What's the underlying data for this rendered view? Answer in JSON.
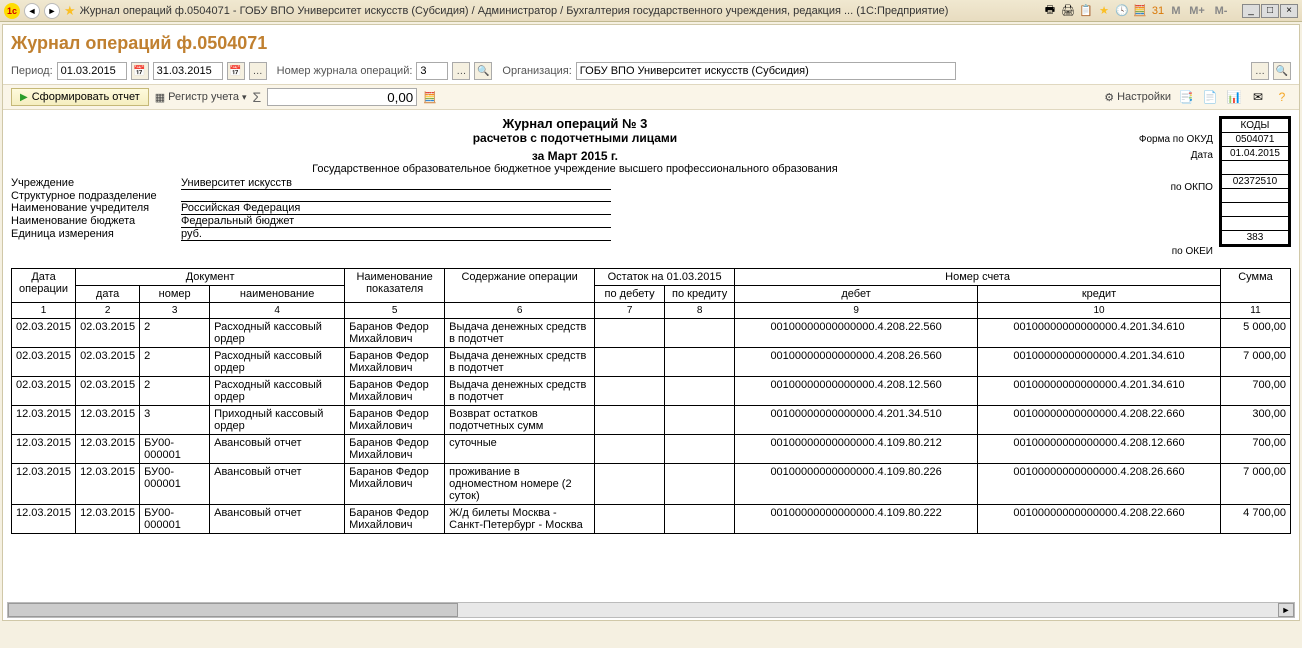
{
  "titlebar": {
    "text": "Журнал операций ф.0504071 - ГОБУ ВПО Университет искусств (Субсидия) / Администратор / Бухгалтерия государственного учреждения, редакция ...  (1С:Предприятие)",
    "m_btns": [
      "M",
      "M+",
      "M-"
    ]
  },
  "page_title": "Журнал операций ф.0504071",
  "params": {
    "period_label": "Период:",
    "date_from": "01.03.2015",
    "date_to": "31.03.2015",
    "journal_num_label": "Номер журнала операций:",
    "journal_num": "3",
    "org_label": "Организация:",
    "org": "ГОБУ ВПО Университет искусств (Субсидия)"
  },
  "toolbar": {
    "generate": "Сформировать отчет",
    "register": "Регистр учета",
    "sum": "0,00",
    "settings": "Настройки"
  },
  "report": {
    "title1": "Журнал операций № 3",
    "title2": "расчетов с подотчетными лицами",
    "title3": "за Март 2015 г.",
    "org_line": "Государственное образовательное бюджетное учреждение высшего профессионального образования",
    "info": {
      "uchr_lbl": "Учреждение",
      "uchr_val": "Университет искусств",
      "podr_lbl": "Структурное подразделение",
      "podr_val": "",
      "founder_lbl": "Наименование учредителя",
      "founder_val": "Российская Федерация",
      "budget_lbl": "Наименование бюджета",
      "budget_val": "Федеральный бюджет",
      "unit_lbl": "Единица измерения",
      "unit_val": "руб."
    },
    "codes": {
      "head": "КОДЫ",
      "okud_lbl": "Форма по ОКУД",
      "okud": "0504071",
      "date_lbl": "Дата",
      "date": "01.04.2015",
      "okpo_lbl": "по ОКПО",
      "okpo": "02372510",
      "okei_lbl": "по ОКЕИ",
      "okei": "383"
    },
    "headers": {
      "op_date": "Дата операции",
      "doc": "Документ",
      "doc_date": "дата",
      "doc_num": "номер",
      "doc_name": "наименование",
      "indicator": "Наименование показателя",
      "content": "Содержание операции",
      "balance": "Остаток на 01.03.2015",
      "bal_deb": "по дебету",
      "bal_cred": "по кредиту",
      "account": "Номер счета",
      "acc_deb": "дебет",
      "acc_cred": "кредит",
      "sum": "Сумма"
    },
    "colnums": [
      "1",
      "2",
      "3",
      "4",
      "5",
      "6",
      "7",
      "8",
      "9",
      "10",
      "11"
    ],
    "rows": [
      {
        "od": "02.03.2015",
        "dd": "02.03.2015",
        "dn": "2",
        "name": "Расходный кассовый ордер",
        "ind": "Баранов Федор Михайлович",
        "cont": "Выдача денежных средств в подотчет",
        "bd": "",
        "bc": "",
        "deb": "00100000000000000.4.208.22.560",
        "cred": "00100000000000000.4.201.34.610",
        "sum": "5 000,00"
      },
      {
        "od": "02.03.2015",
        "dd": "02.03.2015",
        "dn": "2",
        "name": "Расходный кассовый ордер",
        "ind": "Баранов Федор Михайлович",
        "cont": "Выдача денежных средств в подотчет",
        "bd": "",
        "bc": "",
        "deb": "00100000000000000.4.208.26.560",
        "cred": "00100000000000000.4.201.34.610",
        "sum": "7 000,00"
      },
      {
        "od": "02.03.2015",
        "dd": "02.03.2015",
        "dn": "2",
        "name": "Расходный кассовый ордер",
        "ind": "Баранов Федор Михайлович",
        "cont": "Выдача денежных средств в подотчет",
        "bd": "",
        "bc": "",
        "deb": "00100000000000000.4.208.12.560",
        "cred": "00100000000000000.4.201.34.610",
        "sum": "700,00"
      },
      {
        "od": "12.03.2015",
        "dd": "12.03.2015",
        "dn": "3",
        "name": "Приходный кассовый ордер",
        "ind": "Баранов Федор Михайлович",
        "cont": "Возврат остатков подотчетных сумм",
        "bd": "",
        "bc": "",
        "deb": "00100000000000000.4.201.34.510",
        "cred": "00100000000000000.4.208.22.660",
        "sum": "300,00"
      },
      {
        "od": "12.03.2015",
        "dd": "12.03.2015",
        "dn": "БУ00-000001",
        "name": "Авансовый отчет",
        "ind": "Баранов Федор Михайлович",
        "cont": "суточные",
        "bd": "",
        "bc": "",
        "deb": "00100000000000000.4.109.80.212",
        "cred": "00100000000000000.4.208.12.660",
        "sum": "700,00"
      },
      {
        "od": "12.03.2015",
        "dd": "12.03.2015",
        "dn": "БУ00-000001",
        "name": "Авансовый отчет",
        "ind": "Баранов Федор Михайлович",
        "cont": " проживание в одноместном номере (2 суток)",
        "bd": "",
        "bc": "",
        "deb": "00100000000000000.4.109.80.226",
        "cred": "00100000000000000.4.208.26.660",
        "sum": "7 000,00"
      },
      {
        "od": "12.03.2015",
        "dd": "12.03.2015",
        "dn": "БУ00-000001",
        "name": "Авансовый отчет",
        "ind": "Баранов Федор Михайлович",
        "cont": "Ж/д билеты Москва - Санкт-Петербург - Москва",
        "bd": "",
        "bc": "",
        "deb": "00100000000000000.4.109.80.222",
        "cred": "00100000000000000.4.208.22.660",
        "sum": "4 700,00"
      }
    ]
  }
}
